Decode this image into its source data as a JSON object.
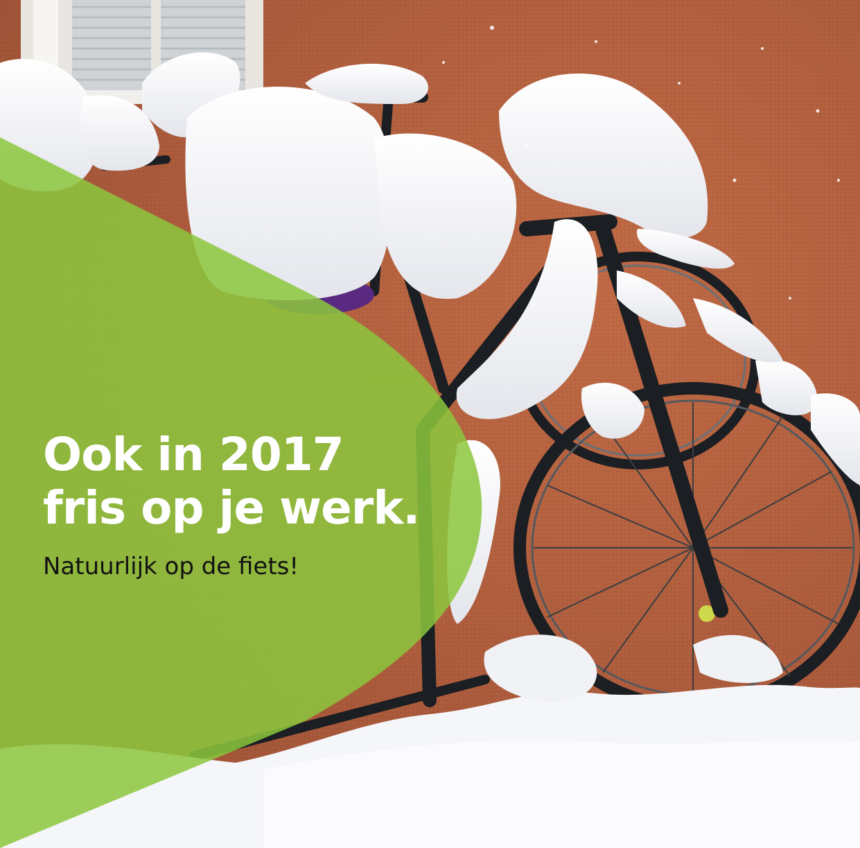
{
  "headline": {
    "line1": "Ook in 2017",
    "line2": "fris op je werk."
  },
  "tagline": "Natuurlijk op de fiets!",
  "colors": {
    "banner_green": "#8cc63e",
    "headline_text": "#ffffff",
    "tagline_text": "#111111",
    "wall": "#b35f3e",
    "snow": "#f4f4f6",
    "bike_frame": "#1b1e22"
  },
  "photo_subject": "snow-covered-bicycles"
}
